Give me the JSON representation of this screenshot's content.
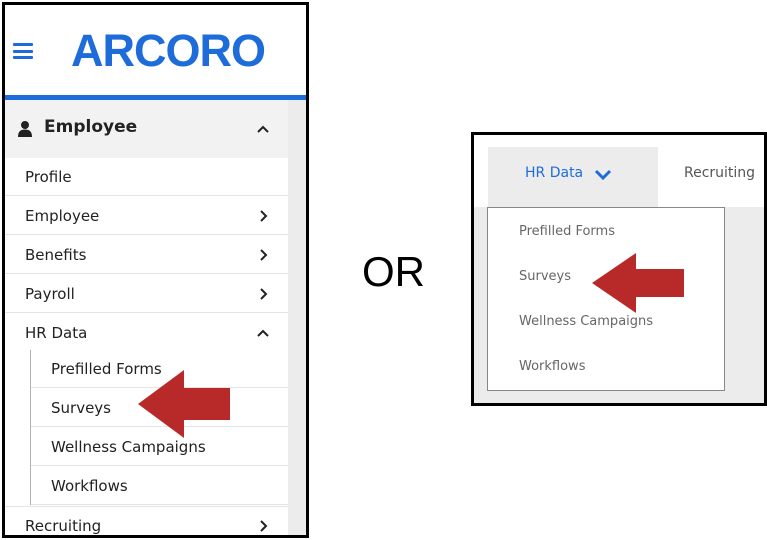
{
  "left": {
    "logo_text": "ARCORO",
    "section_title": "Employee",
    "menu": [
      {
        "label": "Profile"
      },
      {
        "label": "Employee"
      },
      {
        "label": "Benefits"
      },
      {
        "label": "Payroll"
      },
      {
        "label": "HR Data"
      }
    ],
    "submenu": [
      {
        "label": "Prefilled Forms"
      },
      {
        "label": "Surveys"
      },
      {
        "label": "Wellness Campaigns"
      },
      {
        "label": "Workflows"
      }
    ],
    "bottom_item": {
      "label": "Recruiting"
    }
  },
  "separator_text": "OR",
  "right": {
    "active_tab": "HR Data",
    "next_tab": "Recruiting",
    "dropdown": [
      {
        "label": "Prefilled Forms"
      },
      {
        "label": "Surveys"
      },
      {
        "label": "Wellness Campaigns"
      },
      {
        "label": "Workflows"
      }
    ]
  },
  "colors": {
    "brand_blue": "#1e6cd9",
    "arrow_red": "#b82a2a",
    "header_gray": "#f2f2f2"
  }
}
